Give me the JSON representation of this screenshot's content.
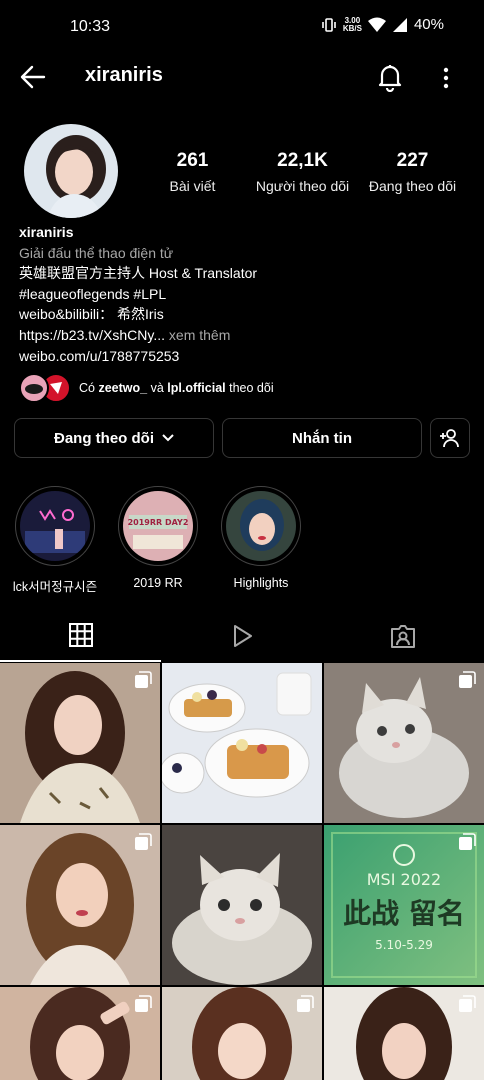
{
  "status_bar": {
    "time": "10:33",
    "speed_value": "3.00",
    "speed_unit": "KB/S",
    "battery": "40%"
  },
  "header": {
    "username": "xiraniris"
  },
  "profile": {
    "stats": [
      {
        "value": "261",
        "label": "Bài viết"
      },
      {
        "value": "22,1K",
        "label": "Người theo dõi"
      },
      {
        "value": "227",
        "label": "Đang theo dõi"
      }
    ],
    "name": "xiraniris",
    "category": "Giải đấu thể thao điện tử",
    "bio_lines": [
      "英雄联盟官方主持人 Host & Translator",
      "#leagueoflegends #LPL",
      "weibo&bilibili： 希然Iris"
    ],
    "link_truncated": "https://b23.tv/XshCNy...",
    "see_more": "xem thêm",
    "link2": "weibo.com/u/1788775253"
  },
  "followed_by": {
    "prefix": "Có",
    "user1": "zeetwo_",
    "and": "và",
    "user2": "lpl.official",
    "suffix": "theo dõi"
  },
  "actions": {
    "following": "Đang theo dõi",
    "message": "Nhắn tin"
  },
  "highlights": [
    {
      "label": "lck서머정규시즌"
    },
    {
      "label": "2019 RR"
    },
    {
      "label": "Highlights"
    }
  ],
  "grid_texts": {
    "msi_title": "MSI 2022",
    "msi_sub": "此战 留名",
    "msi_dates": "5.10-5.29",
    "rr_thumb": "2019RR DAY2"
  },
  "colors": {
    "background": "#000000",
    "secondary_text": "#a8a8a8",
    "border": "#363636"
  }
}
